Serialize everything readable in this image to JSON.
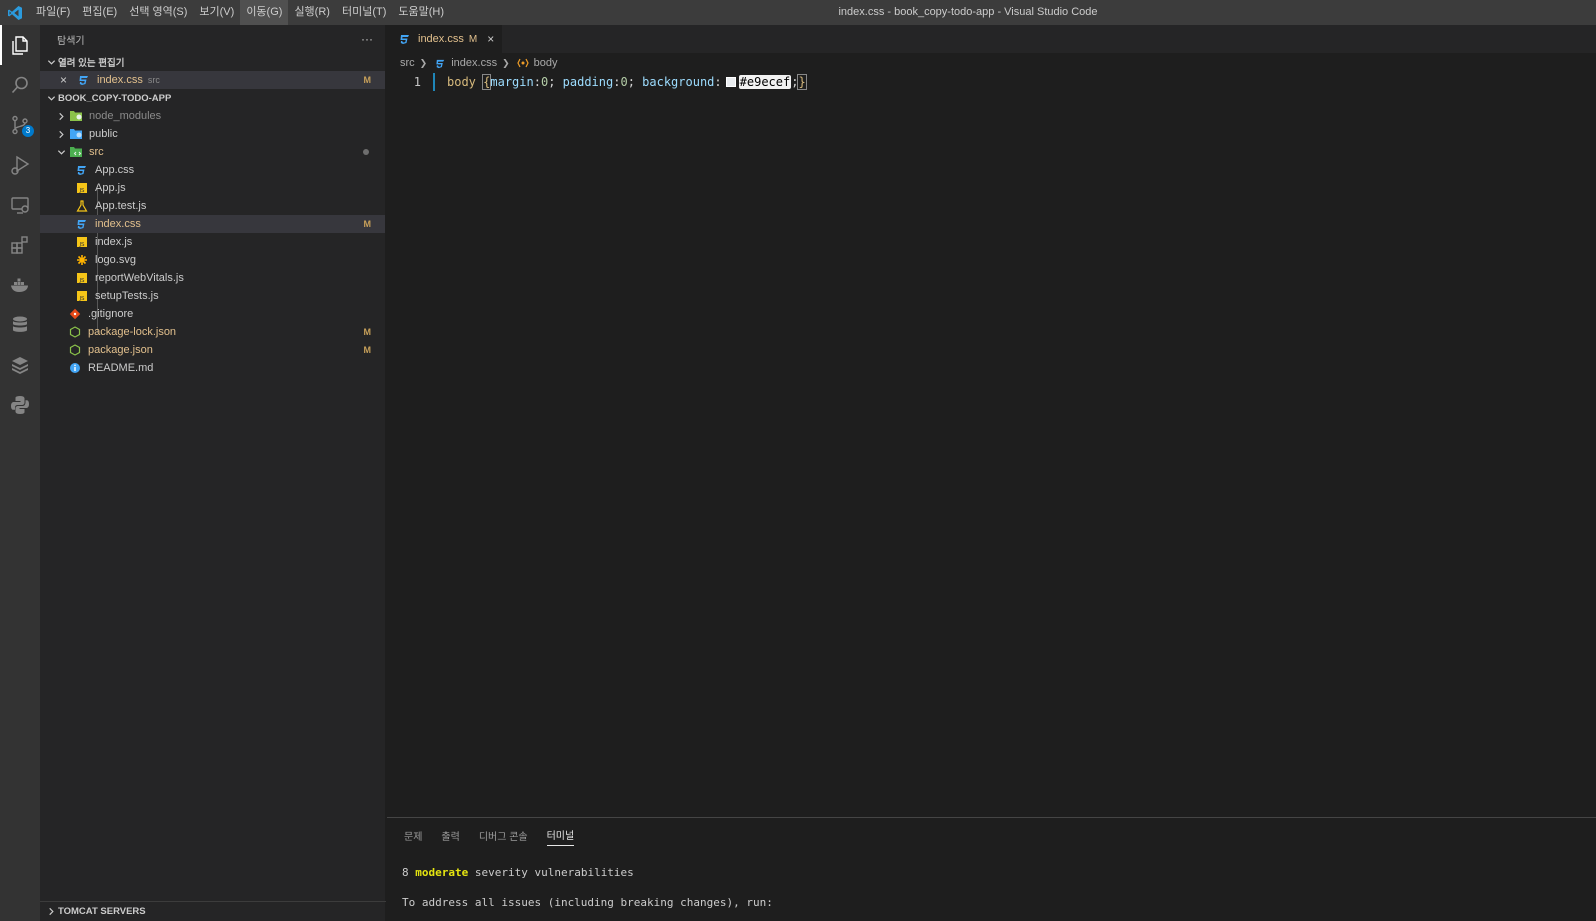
{
  "titlebar": {
    "window_title": "index.css - book_copy-todo-app - Visual Studio Code",
    "menu": [
      "파일(F)",
      "편집(E)",
      "선택 영역(S)",
      "보기(V)",
      "이동(G)",
      "실행(R)",
      "터미널(T)",
      "도움말(H)"
    ],
    "active_menu": "이동(G)"
  },
  "activitybar": {
    "icons": [
      "explorer-icon",
      "search-icon",
      "source-control-icon",
      "run-debug-icon",
      "remote-explorer-icon",
      "extensions-icon",
      "docker-icon",
      "database-icon",
      "stack-icon",
      "python-icon"
    ],
    "scm_badge": "3"
  },
  "sidebar": {
    "title": "탐색기",
    "more": "···",
    "open_editors": {
      "header": "열려 있는 편집기",
      "items": [
        {
          "name": "index.css",
          "folder": "src",
          "status": "M"
        }
      ]
    },
    "project": {
      "header": "BOOK_COPY-TODO-APP",
      "folders": {
        "node_modules": "node_modules",
        "public": "public",
        "src": "src"
      },
      "src_files": [
        {
          "name": "App.css",
          "icon": "css-icon"
        },
        {
          "name": "App.js",
          "icon": "js-icon"
        },
        {
          "name": "App.test.js",
          "icon": "test-icon"
        },
        {
          "name": "index.css",
          "icon": "css-icon",
          "status": "M"
        },
        {
          "name": "index.js",
          "icon": "js-icon"
        },
        {
          "name": "logo.svg",
          "icon": "svg-icon"
        },
        {
          "name": "reportWebVitals.js",
          "icon": "js-icon"
        },
        {
          "name": "setupTests.js",
          "icon": "js-icon"
        }
      ],
      "root_files": [
        {
          "name": ".gitignore",
          "icon": "git-icon"
        },
        {
          "name": "package-lock.json",
          "icon": "npm-icon",
          "status": "M"
        },
        {
          "name": "package.json",
          "icon": "npm-icon",
          "status": "M"
        },
        {
          "name": "README.md",
          "icon": "info-icon"
        }
      ]
    },
    "tomcat": "TOMCAT SERVERS"
  },
  "editor": {
    "tab": {
      "label": "index.css",
      "status": "M",
      "close": "×"
    },
    "breadcrumb": {
      "folder": "src",
      "file": "index.css",
      "symbol": "body"
    },
    "line_number": "1",
    "code": {
      "selector": "body",
      "open_brace": "{",
      "prop1": "margin",
      "val1": "0",
      "prop2": "padding",
      "val2": "0",
      "prop3": "background",
      "color_value": "#e9ecef",
      "close_brace": "}",
      "swatch_color": "#e9ecef"
    }
  },
  "panel": {
    "tabs": [
      "문제",
      "출력",
      "디버그 콘솔",
      "터미널"
    ],
    "active_tab": "터미널",
    "terminal": {
      "line1_count": "8",
      "line1_keyword": "moderate",
      "line1_rest": "severity vulnerabilities",
      "line2": "To address all issues (including breaking changes), run:"
    }
  }
}
